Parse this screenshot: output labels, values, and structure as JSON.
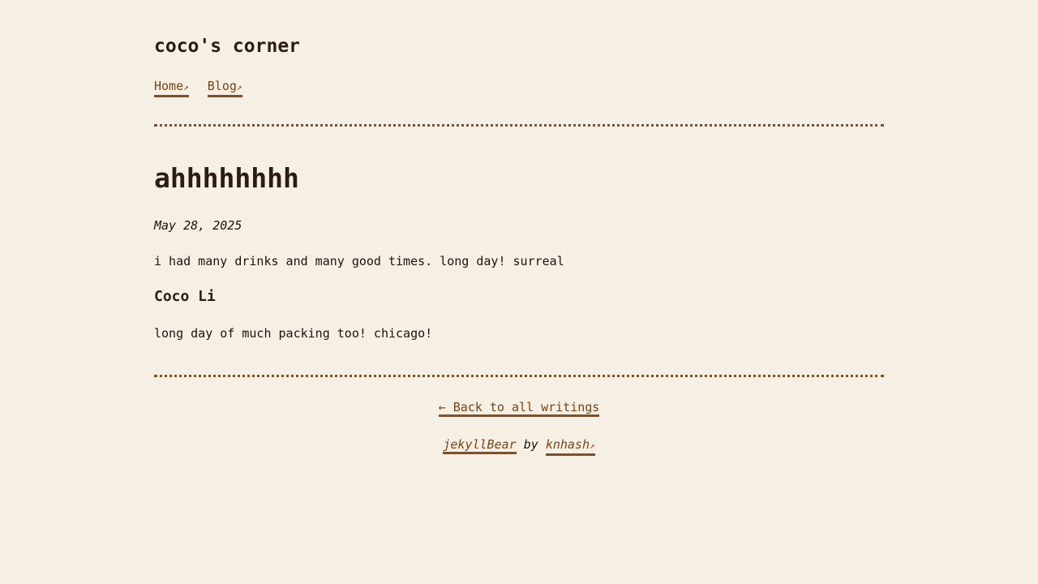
{
  "header": {
    "site_title": "coco's corner",
    "nav": [
      {
        "label": "Home",
        "arrow": "↗"
      },
      {
        "label": "Blog",
        "arrow": "↗"
      }
    ]
  },
  "post": {
    "title": "ahhhhhhhh",
    "date": "May 28, 2025",
    "paragraph_1": "i had many drinks and many good times. long day! surreal",
    "subheading": "Coco Li",
    "paragraph_2": "long day of much packing too! chicago!"
  },
  "footer": {
    "back_link": "← Back to all writings",
    "theme_link": "jekyllBear",
    "by_text": "by",
    "author_link": "knhash",
    "author_arrow": "↗"
  },
  "colors": {
    "background": "#f6f0e4",
    "link": "#7a4316",
    "underline": "#8a4d22",
    "heading": "#2b1d12"
  }
}
